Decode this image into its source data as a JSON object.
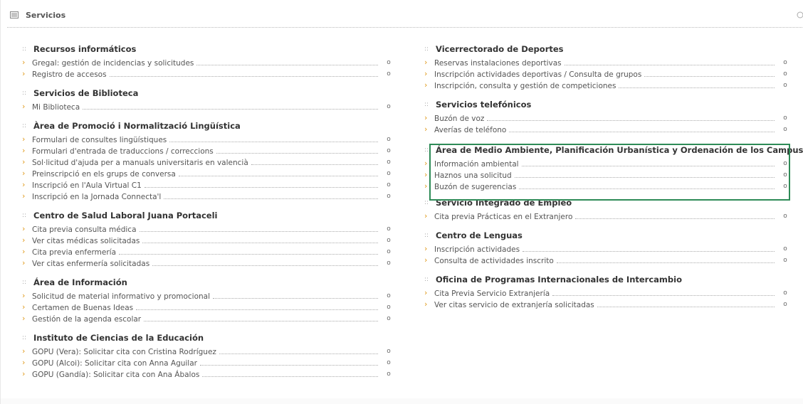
{
  "header": {
    "title": "Servicios",
    "icons": {
      "left": "document-list-icon",
      "right": "expand-icon"
    }
  },
  "left_column": [
    {
      "title": "Recursos informáticos",
      "items": [
        "Gregal: gestión de incidencias y solicitudes",
        "Registro de accesos"
      ]
    },
    {
      "title": "Servicios de Biblioteca",
      "items": [
        "Mi Biblioteca"
      ]
    },
    {
      "title": "Àrea de Promoció i Normalització Lingüística",
      "items": [
        "Formulari de consultes lingüístiques",
        "Formulari d'entrada de traduccions / correccions",
        "Sol·licitud d'ajuda per a manuals universitaris en valencià",
        "Preinscripció en els grups de conversa",
        "Inscripció en l'Aula Virtual C1",
        "Inscripció en la Jornada Connecta'l"
      ]
    },
    {
      "title": "Centro de Salud Laboral Juana Portaceli",
      "items": [
        "Cita previa consulta médica",
        "Ver citas médicas solicitadas",
        "Cita previa enfermería",
        "Ver citas enfermería solicitadas"
      ]
    },
    {
      "title": "Área de Información",
      "items": [
        "Solicitud de material informativo y promocional",
        "Certamen de Buenas Ideas",
        "Gestión de la agenda escolar"
      ]
    },
    {
      "title": "Instituto de Ciencias de la Educación",
      "items": [
        "GOPU (Vera): Solicitar cita con Cristina Rodríguez",
        "GOPU (Alcoi): Solicitar cita con Anna Aguilar",
        "GOPU (Gandía): Solicitar cita con Ana Ábalos"
      ]
    }
  ],
  "right_column": [
    {
      "title": "Vicerrectorado de Deportes",
      "items": [
        "Reservas instalaciones deportivas",
        "Inscripción actividades deportivas / Consulta de grupos",
        "Inscripción, consulta y gestión de competiciones"
      ]
    },
    {
      "title": "Servicios telefónicos",
      "items": [
        "Buzón de voz",
        "Averías de teléfono"
      ]
    },
    {
      "title": "Área de Medio Ambiente, Planificación Urbanística y Ordenación de los Campus",
      "items": [
        "Información ambiental",
        "Haznos una solicitud",
        "Buzón de sugerencias"
      ]
    },
    {
      "title": "Servicio Integrado de Empleo",
      "items": [
        "Cita previa Prácticas en el Extranjero"
      ]
    },
    {
      "title": "Centro de Lenguas",
      "items": [
        "Inscripción actividades",
        "Consulta de actividades inscrito"
      ]
    },
    {
      "title": "Oficina de Programas Internacionales de Intercambio",
      "items": [
        "Cita Previa Servicio Extranjería",
        "Ver citas servicio de extranjería solicitadas"
      ]
    }
  ],
  "symbols": {
    "section_bullet": "::",
    "item_arrow": "›",
    "item_end": "o"
  },
  "colors": {
    "arrow": "#e09a1c",
    "highlight_border": "#2e8b57"
  }
}
